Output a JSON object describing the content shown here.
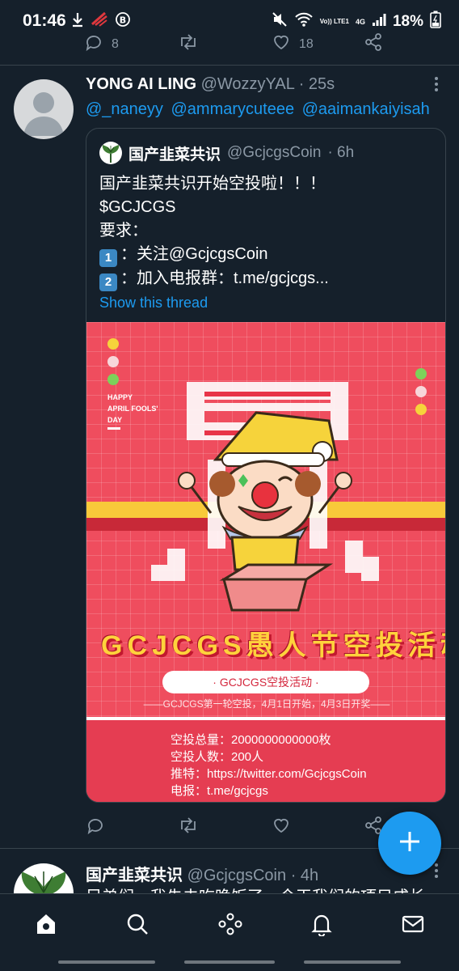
{
  "status_bar": {
    "time": "01:46",
    "battery": "18%",
    "icons": [
      "download-icon",
      "signal-alert-icon",
      "b-icon",
      "mute-icon",
      "wifi-icon",
      "volte-icon",
      "4g-icon",
      "signal-icon",
      "battery-icon"
    ],
    "network_label": "Vo)) LTE1",
    "network_gen": "4G"
  },
  "prev_tweet": {
    "reply_count": "8",
    "like_count": "18"
  },
  "tweet": {
    "name": "YONG AI LING",
    "handle": "@WozzyYAL",
    "time": "· 25s",
    "mentions": [
      "@_naneyy",
      "@ammarycuteee",
      "@aaimankaiyisah"
    ],
    "quote": {
      "name": "国产韭菜共识",
      "handle": "@GcjcgsCoin",
      "time": "· 6h",
      "lines": [
        "国产韭菜共识开始空投啦！！！",
        "$GCJCGS",
        "要求："
      ],
      "item1_emoji": "1",
      "item1_text": "：关注@GcjcgsCoin",
      "item2_emoji": "2",
      "item2_text": "：加入电报群：t.me/gcjcgs...",
      "show_thread": "Show this thread",
      "poster": {
        "april_lines": [
          "HAPPY",
          "APRIL FOOLS'",
          "DAY"
        ],
        "banner": "GCJCGS愚人节空投活动",
        "pill": "· GCJCGS空投活动 ·",
        "subline": "——GCJCGS第一轮空投，4月1日开始，4月3日开奖——",
        "info": [
          "空投总量：2000000000000枚",
          "空投人数：200人",
          "推特：https://twitter.com/GcjcgsCoin",
          "电报：t.me/gcjcgs"
        ]
      }
    }
  },
  "next_tweet": {
    "name": "国产韭菜共识",
    "handle": "@GcjcgsCoin",
    "time": "· 4h",
    "text": "兄弟们，我先去吃晚饭了，今天我们的项目成长"
  },
  "bottom_nav": [
    "home",
    "search",
    "spaces",
    "notifications",
    "messages"
  ],
  "colors": {
    "background": "#15202b",
    "accent": "#1d9bf0",
    "muted": "#8b98a5",
    "poster_red": "#ef4d5e",
    "banner_gold": "#ffd23c"
  }
}
